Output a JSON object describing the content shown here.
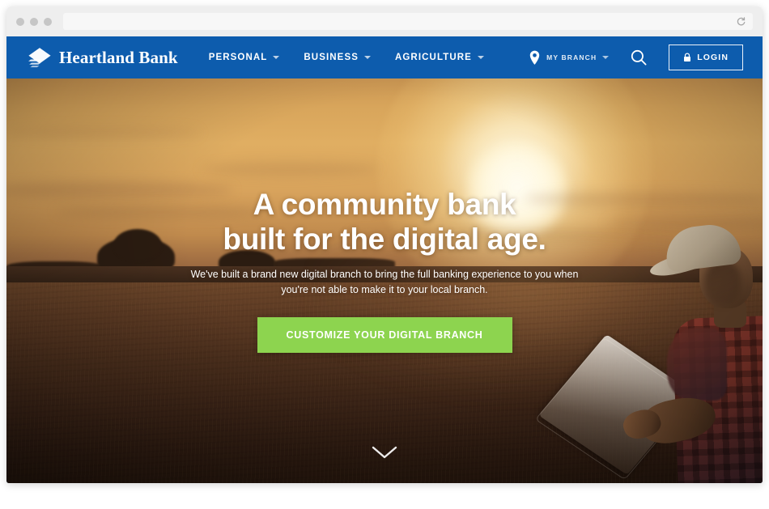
{
  "browser": {
    "url_value": "",
    "url_placeholder": "",
    "reload_icon": "reload-icon",
    "traffic_lights": [
      "close",
      "minimize",
      "maximize"
    ]
  },
  "site": {
    "brand": {
      "name": "Heartland Bank",
      "mark_icon": "heartland-diamond-logo"
    },
    "nav": [
      {
        "label": "PERSONAL",
        "has_dropdown": true
      },
      {
        "label": "BUSINESS",
        "has_dropdown": true
      },
      {
        "label": "AGRICULTURE",
        "has_dropdown": true
      }
    ],
    "utility": {
      "branch_label": "MY BRANCH",
      "branch_icon": "map-pin-icon",
      "search_icon": "search-icon",
      "login_label": "LOGIN",
      "login_icon": "lock-icon"
    },
    "hero": {
      "headline_line1": "A community bank",
      "headline_line2": "built for the digital age.",
      "subhead": "We've built a brand new digital branch to bring the full banking experience to you when you're not able to make it to your local branch.",
      "cta_label": "CUSTOMIZE YOUR DIGITAL BRANCH",
      "scroll_icon": "chevron-down-icon"
    }
  },
  "colors": {
    "brand_blue": "#0d5cad",
    "cta_green": "#8dd44f",
    "nav_text": "#ffffff",
    "titlebar": "#eeeeee",
    "traffic_dot": "#c6c6c6"
  }
}
